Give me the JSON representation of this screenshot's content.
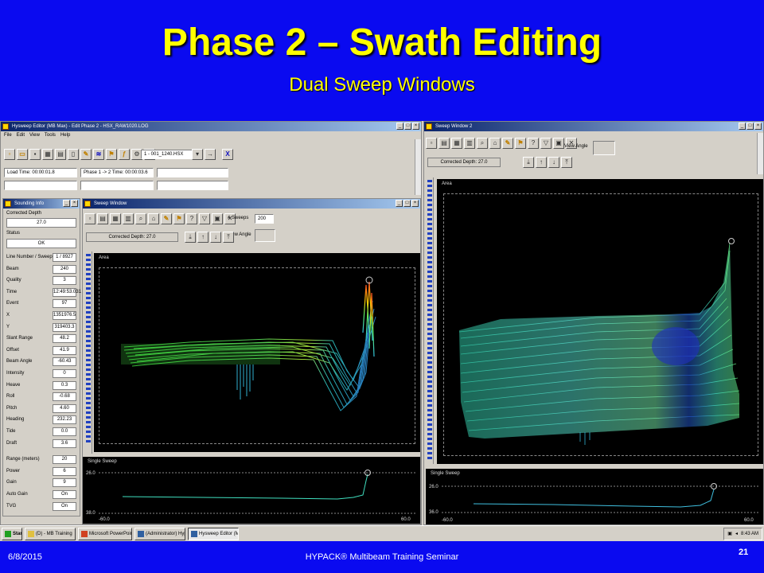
{
  "slide": {
    "title": "Phase 2 – Swath Editing",
    "subtitle": "Dual Sweep Windows",
    "date": "6/8/2015",
    "footer_center": "HYPACK® Multibeam Training Seminar",
    "page_number": "21"
  },
  "editor": {
    "title": "Hysweep Editor (MB Max) - Edit Phase 2 - HSX_RAW1020.LOG",
    "menu": [
      "File",
      "Edit",
      "View",
      "Tools",
      "Help"
    ],
    "line_select": "1 - 001_1240.HSX",
    "load_time": "Load Time: 00:00:01.8",
    "phase_time": "Phase 1 -> 2 Time: 00:00:03.6"
  },
  "sounding_info": {
    "title": "Sounding Info",
    "corrected_depth_label": "Corrected Depth",
    "corrected_depth_value": "27.0",
    "status_label": "Status",
    "status_value": "OK",
    "rows": [
      {
        "label": "Line Number / Sweep",
        "value": "1 / 8927"
      },
      {
        "label": "Beam",
        "value": "240"
      },
      {
        "label": "Quality",
        "value": "3"
      },
      {
        "label": "Time",
        "value": "12:49:53.031"
      },
      {
        "label": "Event",
        "value": "97"
      },
      {
        "label": "X",
        "value": "1351976.5"
      },
      {
        "label": "Y",
        "value": "319403.3"
      },
      {
        "label": "Slant Range",
        "value": "48.2"
      },
      {
        "label": "Offset",
        "value": "41.9"
      },
      {
        "label": "Beam Angle",
        "value": "-60.43"
      },
      {
        "label": "Intensity",
        "value": "0"
      },
      {
        "label": "Heave",
        "value": "0.3"
      },
      {
        "label": "Roll",
        "value": "-0.68"
      },
      {
        "label": "Pitch",
        "value": "4.60"
      },
      {
        "label": "Heading",
        "value": "232.23"
      },
      {
        "label": "Tide",
        "value": "0.0"
      },
      {
        "label": "Draft",
        "value": "3.6"
      },
      {
        "label": "Range (meters)",
        "value": "20"
      },
      {
        "label": "Power",
        "value": "6"
      },
      {
        "label": "Gain",
        "value": "9"
      },
      {
        "label": "Auto Gain",
        "value": "On"
      },
      {
        "label": "TVG",
        "value": "On"
      }
    ]
  },
  "sweep1": {
    "title": "Sweep Window",
    "sweeps_label": "# Sweeps",
    "sweeps_value": "200",
    "view_angle_label": "View Angle",
    "corrected_depth": "Corrected Depth: 27.0",
    "area_label": "Area",
    "single_sweep_label": "Single Sweep",
    "axis_top": "26.0",
    "axis_bottom": "38.0",
    "x_left": "-60.0",
    "x_right": "60.0"
  },
  "sweep2": {
    "title": "Sweep Window 2",
    "view_angle_label": "View Angle",
    "corrected_depth": "Corrected Depth: 27.0",
    "area_label": "Area",
    "single_sweep_label": "Single Sweep",
    "axis_top": "26.0",
    "axis_bottom": "36.0",
    "x_left": "-60.0",
    "x_right": "60.0"
  },
  "taskbar": {
    "start": "Start",
    "items": [
      "(D) - MB Training",
      "Microsoft PowerPoint no...",
      "(Administrator) Hypack -...",
      "Hysweep Editor (MB ..."
    ],
    "clock": "8:43 AM"
  },
  "colors": {
    "slide_bg": "#0a0af0",
    "title": "#ffff00",
    "titlebar_active": "#0a246a"
  }
}
